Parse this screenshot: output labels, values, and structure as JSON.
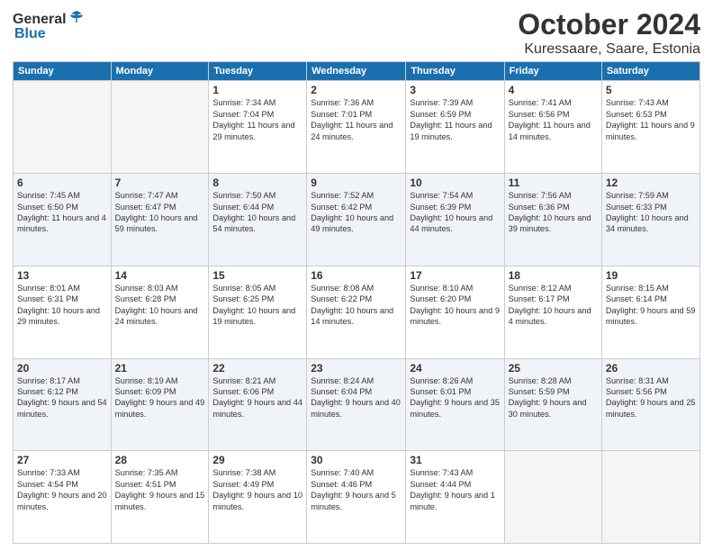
{
  "logo": {
    "general": "General",
    "blue": "Blue"
  },
  "header": {
    "month": "October 2024",
    "location": "Kuressaare, Saare, Estonia"
  },
  "weekdays": [
    "Sunday",
    "Monday",
    "Tuesday",
    "Wednesday",
    "Thursday",
    "Friday",
    "Saturday"
  ],
  "weeks": [
    [
      {
        "day": "",
        "sunrise": "",
        "sunset": "",
        "daylight": ""
      },
      {
        "day": "",
        "sunrise": "",
        "sunset": "",
        "daylight": ""
      },
      {
        "day": "1",
        "sunrise": "Sunrise: 7:34 AM",
        "sunset": "Sunset: 7:04 PM",
        "daylight": "Daylight: 11 hours and 29 minutes."
      },
      {
        "day": "2",
        "sunrise": "Sunrise: 7:36 AM",
        "sunset": "Sunset: 7:01 PM",
        "daylight": "Daylight: 11 hours and 24 minutes."
      },
      {
        "day": "3",
        "sunrise": "Sunrise: 7:39 AM",
        "sunset": "Sunset: 6:59 PM",
        "daylight": "Daylight: 11 hours and 19 minutes."
      },
      {
        "day": "4",
        "sunrise": "Sunrise: 7:41 AM",
        "sunset": "Sunset: 6:56 PM",
        "daylight": "Daylight: 11 hours and 14 minutes."
      },
      {
        "day": "5",
        "sunrise": "Sunrise: 7:43 AM",
        "sunset": "Sunset: 6:53 PM",
        "daylight": "Daylight: 11 hours and 9 minutes."
      }
    ],
    [
      {
        "day": "6",
        "sunrise": "Sunrise: 7:45 AM",
        "sunset": "Sunset: 6:50 PM",
        "daylight": "Daylight: 11 hours and 4 minutes."
      },
      {
        "day": "7",
        "sunrise": "Sunrise: 7:47 AM",
        "sunset": "Sunset: 6:47 PM",
        "daylight": "Daylight: 10 hours and 59 minutes."
      },
      {
        "day": "8",
        "sunrise": "Sunrise: 7:50 AM",
        "sunset": "Sunset: 6:44 PM",
        "daylight": "Daylight: 10 hours and 54 minutes."
      },
      {
        "day": "9",
        "sunrise": "Sunrise: 7:52 AM",
        "sunset": "Sunset: 6:42 PM",
        "daylight": "Daylight: 10 hours and 49 minutes."
      },
      {
        "day": "10",
        "sunrise": "Sunrise: 7:54 AM",
        "sunset": "Sunset: 6:39 PM",
        "daylight": "Daylight: 10 hours and 44 minutes."
      },
      {
        "day": "11",
        "sunrise": "Sunrise: 7:56 AM",
        "sunset": "Sunset: 6:36 PM",
        "daylight": "Daylight: 10 hours and 39 minutes."
      },
      {
        "day": "12",
        "sunrise": "Sunrise: 7:59 AM",
        "sunset": "Sunset: 6:33 PM",
        "daylight": "Daylight: 10 hours and 34 minutes."
      }
    ],
    [
      {
        "day": "13",
        "sunrise": "Sunrise: 8:01 AM",
        "sunset": "Sunset: 6:31 PM",
        "daylight": "Daylight: 10 hours and 29 minutes."
      },
      {
        "day": "14",
        "sunrise": "Sunrise: 8:03 AM",
        "sunset": "Sunset: 6:28 PM",
        "daylight": "Daylight: 10 hours and 24 minutes."
      },
      {
        "day": "15",
        "sunrise": "Sunrise: 8:05 AM",
        "sunset": "Sunset: 6:25 PM",
        "daylight": "Daylight: 10 hours and 19 minutes."
      },
      {
        "day": "16",
        "sunrise": "Sunrise: 8:08 AM",
        "sunset": "Sunset: 6:22 PM",
        "daylight": "Daylight: 10 hours and 14 minutes."
      },
      {
        "day": "17",
        "sunrise": "Sunrise: 8:10 AM",
        "sunset": "Sunset: 6:20 PM",
        "daylight": "Daylight: 10 hours and 9 minutes."
      },
      {
        "day": "18",
        "sunrise": "Sunrise: 8:12 AM",
        "sunset": "Sunset: 6:17 PM",
        "daylight": "Daylight: 10 hours and 4 minutes."
      },
      {
        "day": "19",
        "sunrise": "Sunrise: 8:15 AM",
        "sunset": "Sunset: 6:14 PM",
        "daylight": "Daylight: 9 hours and 59 minutes."
      }
    ],
    [
      {
        "day": "20",
        "sunrise": "Sunrise: 8:17 AM",
        "sunset": "Sunset: 6:12 PM",
        "daylight": "Daylight: 9 hours and 54 minutes."
      },
      {
        "day": "21",
        "sunrise": "Sunrise: 8:19 AM",
        "sunset": "Sunset: 6:09 PM",
        "daylight": "Daylight: 9 hours and 49 minutes."
      },
      {
        "day": "22",
        "sunrise": "Sunrise: 8:21 AM",
        "sunset": "Sunset: 6:06 PM",
        "daylight": "Daylight: 9 hours and 44 minutes."
      },
      {
        "day": "23",
        "sunrise": "Sunrise: 8:24 AM",
        "sunset": "Sunset: 6:04 PM",
        "daylight": "Daylight: 9 hours and 40 minutes."
      },
      {
        "day": "24",
        "sunrise": "Sunrise: 8:26 AM",
        "sunset": "Sunset: 6:01 PM",
        "daylight": "Daylight: 9 hours and 35 minutes."
      },
      {
        "day": "25",
        "sunrise": "Sunrise: 8:28 AM",
        "sunset": "Sunset: 5:59 PM",
        "daylight": "Daylight: 9 hours and 30 minutes."
      },
      {
        "day": "26",
        "sunrise": "Sunrise: 8:31 AM",
        "sunset": "Sunset: 5:56 PM",
        "daylight": "Daylight: 9 hours and 25 minutes."
      }
    ],
    [
      {
        "day": "27",
        "sunrise": "Sunrise: 7:33 AM",
        "sunset": "Sunset: 4:54 PM",
        "daylight": "Daylight: 9 hours and 20 minutes."
      },
      {
        "day": "28",
        "sunrise": "Sunrise: 7:35 AM",
        "sunset": "Sunset: 4:51 PM",
        "daylight": "Daylight: 9 hours and 15 minutes."
      },
      {
        "day": "29",
        "sunrise": "Sunrise: 7:38 AM",
        "sunset": "Sunset: 4:49 PM",
        "daylight": "Daylight: 9 hours and 10 minutes."
      },
      {
        "day": "30",
        "sunrise": "Sunrise: 7:40 AM",
        "sunset": "Sunset: 4:46 PM",
        "daylight": "Daylight: 9 hours and 5 minutes."
      },
      {
        "day": "31",
        "sunrise": "Sunrise: 7:43 AM",
        "sunset": "Sunset: 4:44 PM",
        "daylight": "Daylight: 9 hours and 1 minute."
      },
      {
        "day": "",
        "sunrise": "",
        "sunset": "",
        "daylight": ""
      },
      {
        "day": "",
        "sunrise": "",
        "sunset": "",
        "daylight": ""
      }
    ]
  ]
}
